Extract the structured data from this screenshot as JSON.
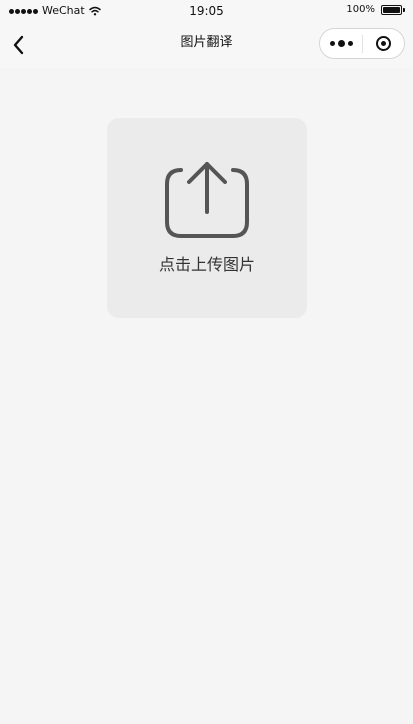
{
  "status_bar": {
    "carrier": "WeChat",
    "time": "19:05",
    "battery_percent": "100%",
    "icons": [
      "signal-icon",
      "wifi-icon",
      "battery-icon"
    ]
  },
  "nav": {
    "title": "图片翻译",
    "back_icon": "back-arrow-icon",
    "capsule": {
      "menu_icon": "more-dots-icon",
      "close_icon": "target-icon"
    }
  },
  "upload": {
    "label": "点击上传图片",
    "icon": "upload-share-icon"
  },
  "colors": {
    "page_background": "#f5f5f5",
    "card_background": "#ebebeb",
    "icon_color": "#555555",
    "text_color": "#333333"
  }
}
